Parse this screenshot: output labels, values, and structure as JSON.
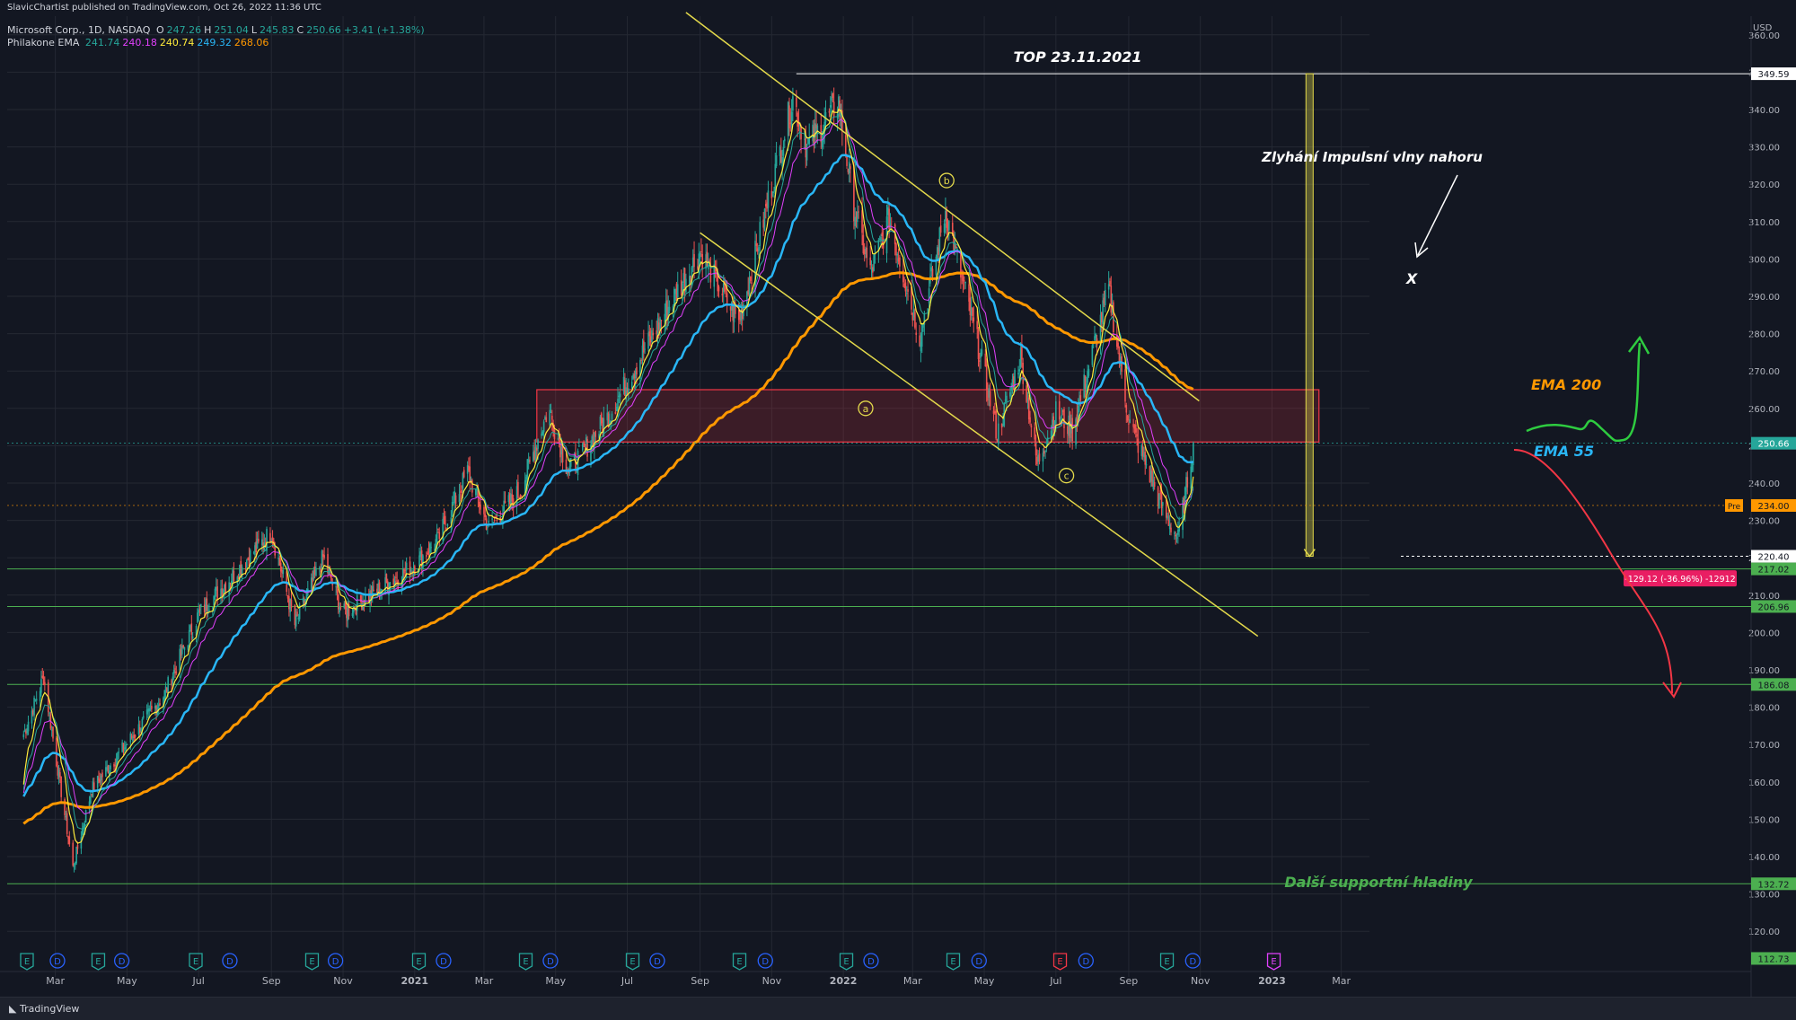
{
  "header": {
    "published": "SlavicChartist published on TradingView.com, Oct 26, 2022 11:36 UTC",
    "symbol_line": "Microsoft Corp., 1D, NASDAQ",
    "ohlc": [
      {
        "k": "O",
        "v": "247.26"
      },
      {
        "k": "H",
        "v": "251.04"
      },
      {
        "k": "L",
        "v": "245.83"
      },
      {
        "k": "C",
        "v": "250.66"
      },
      {
        "k": "",
        "v": "+3.41 (+1.38%)"
      }
    ],
    "indicator_name": "Philakone EMA",
    "indicator_values": [
      {
        "v": "241.74",
        "color": "#26a69a"
      },
      {
        "v": "240.18",
        "color": "#e040fb"
      },
      {
        "v": "240.74",
        "color": "#ffeb3b"
      },
      {
        "v": "249.32",
        "color": "#29b6f6"
      },
      {
        "v": "268.06",
        "color": "#ff9800"
      }
    ]
  },
  "footer": {
    "brand": "TradingView"
  },
  "chart_data": {
    "type": "candlestick",
    "title": "",
    "currency_label": "USD",
    "ylim": [
      115,
      365
    ],
    "y_ticks": [
      120,
      130,
      140,
      150,
      160,
      170,
      180,
      190,
      200,
      210,
      220,
      230,
      240,
      250,
      260,
      270,
      280,
      290,
      300,
      310,
      320,
      330,
      340,
      350,
      360
    ],
    "x_ticks": [
      "Mar",
      "May",
      "Jul",
      "Sep",
      "Nov",
      "2021",
      "Mar",
      "May",
      "Jul",
      "Sep",
      "Nov",
      "2022",
      "Mar",
      "May",
      "Jul",
      "Sep",
      "Nov",
      "2023",
      "Mar"
    ],
    "anchors": [
      {
        "date": "2020-02-01",
        "close": 171
      },
      {
        "date": "2020-02-20",
        "close": 188
      },
      {
        "date": "2020-03-16",
        "close": 137
      },
      {
        "date": "2020-04-01",
        "close": 158
      },
      {
        "date": "2020-06-01",
        "close": 183
      },
      {
        "date": "2020-07-01",
        "close": 205
      },
      {
        "date": "2020-09-01",
        "close": 227
      },
      {
        "date": "2020-09-21",
        "close": 202
      },
      {
        "date": "2020-10-15",
        "close": 220
      },
      {
        "date": "2020-11-01",
        "close": 205
      },
      {
        "date": "2021-01-01",
        "close": 218
      },
      {
        "date": "2021-01-21",
        "close": 225
      },
      {
        "date": "2021-02-15",
        "close": 243
      },
      {
        "date": "2021-03-05",
        "close": 228
      },
      {
        "date": "2021-04-01",
        "close": 238
      },
      {
        "date": "2021-04-25",
        "close": 260
      },
      {
        "date": "2021-05-12",
        "close": 243
      },
      {
        "date": "2021-06-15",
        "close": 258
      },
      {
        "date": "2021-08-01",
        "close": 285
      },
      {
        "date": "2021-09-01",
        "close": 302
      },
      {
        "date": "2021-10-04",
        "close": 283
      },
      {
        "date": "2021-11-19",
        "close": 343
      },
      {
        "date": "2021-12-01",
        "close": 330
      },
      {
        "date": "2021-12-28",
        "close": 342
      },
      {
        "date": "2022-01-10",
        "close": 314
      },
      {
        "date": "2022-01-24",
        "close": 296
      },
      {
        "date": "2022-02-09",
        "close": 311
      },
      {
        "date": "2022-03-07",
        "close": 279
      },
      {
        "date": "2022-03-29",
        "close": 313
      },
      {
        "date": "2022-04-28",
        "close": 274
      },
      {
        "date": "2022-05-12",
        "close": 253
      },
      {
        "date": "2022-06-01",
        "close": 274
      },
      {
        "date": "2022-06-15",
        "close": 245
      },
      {
        "date": "2022-07-01",
        "close": 259
      },
      {
        "date": "2022-07-15",
        "close": 254
      },
      {
        "date": "2022-08-15",
        "close": 292
      },
      {
        "date": "2022-09-01",
        "close": 257
      },
      {
        "date": "2022-09-30",
        "close": 233
      },
      {
        "date": "2022-10-13",
        "close": 225
      },
      {
        "date": "2022-10-26",
        "close": 250.66
      }
    ],
    "ema": [
      {
        "name": "EMA 55",
        "color": "#29b6f6",
        "period": 55
      },
      {
        "name": "EMA 200",
        "color": "#ff9800",
        "period": 200
      }
    ],
    "price_labels": [
      {
        "value": 349.59,
        "text": "349.59",
        "bg": "#ffffff",
        "fg": "#131722"
      },
      {
        "value": 250.66,
        "text": "250.66",
        "bg": "#26a69a",
        "fg": "#ffffff"
      },
      {
        "value": 234.0,
        "text": "234.00",
        "bg": "#ff9800",
        "fg": "#131722",
        "pre": "Pre"
      },
      {
        "value": 220.4,
        "text": "220.40",
        "bg": "#ffffff",
        "fg": "#131722"
      },
      {
        "value": 217.02,
        "text": "217.02",
        "bg": "#4caf50",
        "fg": "#131722"
      },
      {
        "value": 206.96,
        "text": "206.96",
        "bg": "#4caf50",
        "fg": "#131722"
      },
      {
        "value": 186.08,
        "text": "186.08",
        "bg": "#4caf50",
        "fg": "#131722"
      },
      {
        "value": 132.72,
        "text": "132.72",
        "bg": "#4caf50",
        "fg": "#131722"
      },
      {
        "value": 112.73,
        "text": "112.73",
        "bg": "#4caf50",
        "fg": "#131722"
      }
    ],
    "support_lines": [
      217.02,
      206.96,
      186.08,
      132.72
    ],
    "resistance_zone": {
      "from": "2021-04-15",
      "to": "2023-02-10",
      "low": 251,
      "high": 265
    },
    "top_line": {
      "value": 349.59,
      "from": "2021-11-22",
      "to": "2023-02-10"
    },
    "measure": {
      "from": 349.59,
      "to": 220.4,
      "date": "2023-02-02",
      "text": "-129.12 (-36.96%) -12912"
    },
    "channel": [
      {
        "from": {
          "date": "2021-08-20",
          "y": 366
        },
        "to": {
          "date": "2022-10-31",
          "y": 262
        }
      },
      {
        "from": {
          "date": "2021-09-01",
          "y": 307
        },
        "to": {
          "date": "2022-12-20",
          "y": 199
        }
      }
    ],
    "wave_labels": [
      {
        "t": "a",
        "date": "2022-01-20",
        "y": 260
      },
      {
        "t": "b",
        "date": "2022-03-30",
        "y": 321
      },
      {
        "t": "c",
        "date": "2022-07-10",
        "y": 242
      }
    ],
    "annotations": {
      "top": "TOP 23.11.2021",
      "failure": "Zlyhání Impulsní vlny nahoru",
      "x_mark": "X",
      "ema200": "EMA 200",
      "ema55": "EMA 55",
      "supports": "Další supportní hladiny"
    },
    "events": [
      {
        "date": "2020-04-28",
        "t": "E"
      },
      {
        "date": "2020-05-18",
        "t": "D"
      },
      {
        "date": "2020-07-20",
        "t": "E"
      },
      {
        "date": "2020-08-18",
        "t": "D"
      },
      {
        "date": "2020-10-27",
        "t": "E"
      },
      {
        "date": "2020-11-16",
        "t": "D"
      },
      {
        "date": "2021-01-26",
        "t": "E"
      },
      {
        "date": "2021-02-16",
        "t": "D"
      },
      {
        "date": "2021-04-27",
        "t": "E"
      },
      {
        "date": "2021-05-18",
        "t": "D"
      },
      {
        "date": "2021-07-27",
        "t": "E"
      },
      {
        "date": "2021-08-17",
        "t": "D"
      },
      {
        "date": "2021-10-26",
        "t": "E"
      },
      {
        "date": "2021-11-17",
        "t": "D"
      },
      {
        "date": "2022-01-25",
        "t": "E"
      },
      {
        "date": "2022-02-15",
        "t": "D"
      },
      {
        "date": "2022-04-26",
        "t": "E"
      },
      {
        "date": "2022-05-18",
        "t": "D"
      },
      {
        "date": "2022-07-26",
        "t": "E",
        "color": "#f23645"
      },
      {
        "date": "2022-08-17",
        "t": "D"
      },
      {
        "date": "2022-10-25",
        "t": "E"
      },
      {
        "date": "2022-11-16",
        "t": "D"
      },
      {
        "date": "2023-01-24",
        "t": "E",
        "color": "#e040fb"
      }
    ],
    "first_event_date": "2020-03-01"
  }
}
